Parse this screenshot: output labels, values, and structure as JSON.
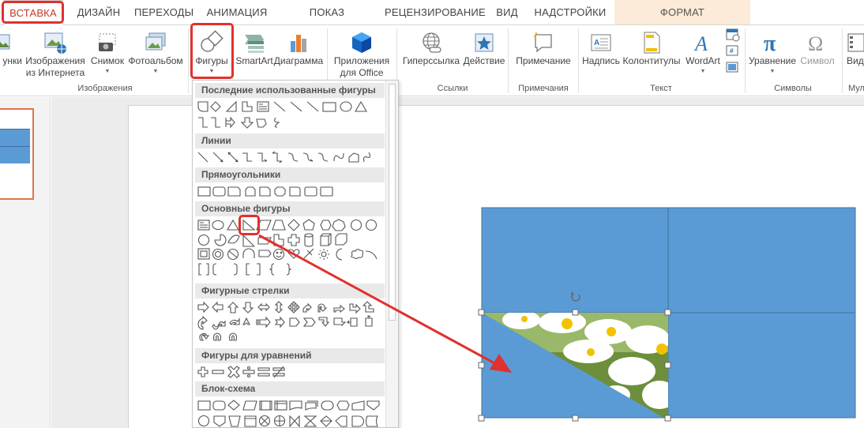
{
  "tabs": [
    "ВСТАВКА",
    "ДИЗАЙН",
    "ПЕРЕХОДЫ",
    "АНИМАЦИЯ",
    "ПОКАЗ СЛАЙДОВ",
    "РЕЦЕНЗИРОВАНИЕ",
    "ВИД",
    "НАДСТРОЙКИ",
    "ФОРМАТ"
  ],
  "ribbon": {
    "pictures_partial": "унки",
    "online_pictures": [
      "Изображения",
      "из Интернета"
    ],
    "screenshot": "Снимок",
    "photo_album": "Фотоальбом",
    "shapes": "Фигуры",
    "smartart": "SmartArt",
    "chart": "Диаграмма",
    "apps": [
      "Приложения",
      "для Office"
    ],
    "hyperlink": "Гиперссылка",
    "action": "Действие",
    "comment": "Примечание",
    "textbox": "Надпись",
    "header_footer": "Колонтитулы",
    "wordart": "WordArt",
    "equation": "Уравнение",
    "symbol": "Символ",
    "video_partial": "Вид",
    "groups": {
      "images": "Изображения",
      "links": "Ссылки",
      "comments": "Примечания",
      "text": "Текст",
      "symbols": "Символы",
      "media_partial": "Мул"
    }
  },
  "menu": {
    "sections": [
      "Последние использованные фигуры",
      "Линии",
      "Прямоугольники",
      "Основные фигуры",
      "Фигурные стрелки",
      "Фигуры для уравнений",
      "Блок-схема"
    ]
  },
  "colors": {
    "accent": "#e0312e",
    "slide_blue": "#5b9bd5",
    "tab_insert": "#c0392b"
  }
}
